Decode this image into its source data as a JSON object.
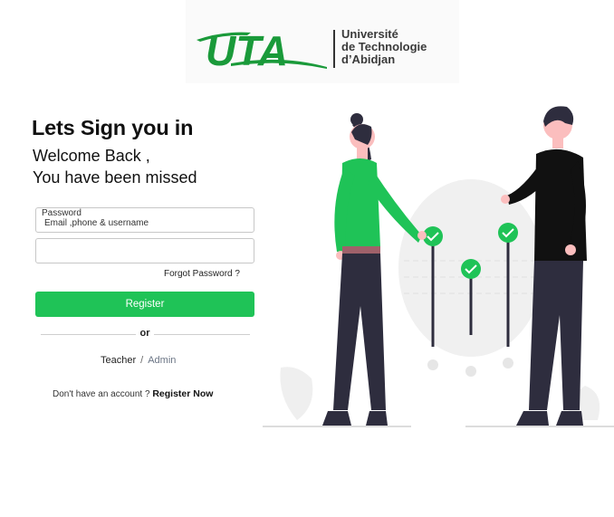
{
  "logo": {
    "mark_text": "UTA",
    "lines": [
      "Université",
      "de Technologie",
      "d’Abidjan"
    ]
  },
  "form": {
    "title": "Lets Sign you in",
    "welcome_line1": "Welcome Back ,",
    "welcome_line2": "You have been missed",
    "field1_label": "Password",
    "field1_placeholder": "Email ,phone & username",
    "field2_value": "",
    "forgot_label": "Forgot Password ?",
    "register_label": "Register",
    "or_label": "or",
    "role_teacher": "Teacher",
    "role_separator": "/",
    "role_admin": "Admin",
    "signup_prompt": "Don't have an account ?",
    "signup_link": "Register Now"
  },
  "colors": {
    "brand_green": "#1fc357",
    "logo_green": "#1a9a3a",
    "text_dark": "#111111"
  },
  "icons": [
    "check-icon",
    "check-icon",
    "check-icon"
  ]
}
